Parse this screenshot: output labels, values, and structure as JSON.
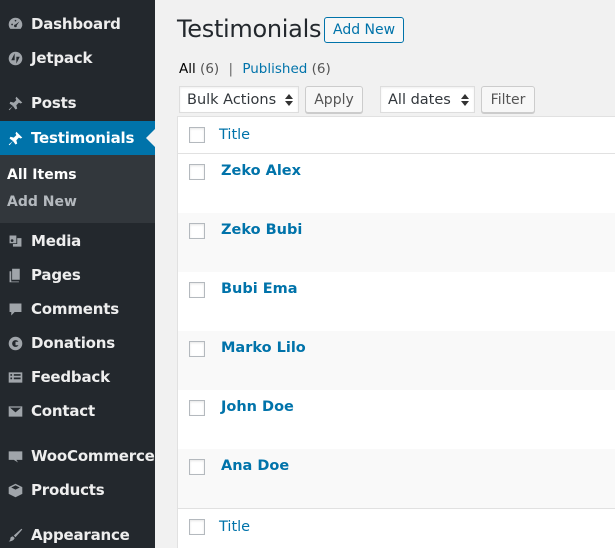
{
  "sidebar": {
    "items": [
      {
        "label": "Dashboard",
        "icon": "dashboard-icon"
      },
      {
        "label": "Jetpack",
        "icon": "jetpack-icon"
      },
      {
        "label": "Posts",
        "icon": "pin-icon"
      },
      {
        "label": "Testimonials",
        "icon": "pin-icon",
        "active": true
      },
      {
        "label": "Media",
        "icon": "media-icon"
      },
      {
        "label": "Pages",
        "icon": "pages-icon"
      },
      {
        "label": "Comments",
        "icon": "comments-icon"
      },
      {
        "label": "Donations",
        "icon": "donations-icon"
      },
      {
        "label": "Feedback",
        "icon": "feedback-icon"
      },
      {
        "label": "Contact",
        "icon": "mail-icon"
      },
      {
        "label": "WooCommerce",
        "icon": "woo-icon"
      },
      {
        "label": "Products",
        "icon": "box-icon"
      },
      {
        "label": "Appearance",
        "icon": "brush-icon"
      }
    ],
    "submenu": [
      "All Items",
      "Add New"
    ]
  },
  "header": {
    "title": "Testimonials",
    "add_new_label": "Add New"
  },
  "filters": {
    "all_label": "All",
    "all_count": "(6)",
    "separator": "|",
    "published_label": "Published",
    "published_count": "(6)"
  },
  "actions": {
    "bulk_selected": "Bulk Actions",
    "apply_label": "Apply",
    "dates_selected": "All dates",
    "filter_label": "Filter"
  },
  "table": {
    "header_title": "Title",
    "footer_title": "Title",
    "rows": [
      "Zeko Alex",
      "Zeko Bubi",
      "Bubi Ema",
      "Marko Lilo",
      "John Doe",
      "Ana Doe"
    ]
  },
  "colors": {
    "sidebar_bg": "#23282d",
    "accent": "#0073aa",
    "link": "#0073aa"
  }
}
